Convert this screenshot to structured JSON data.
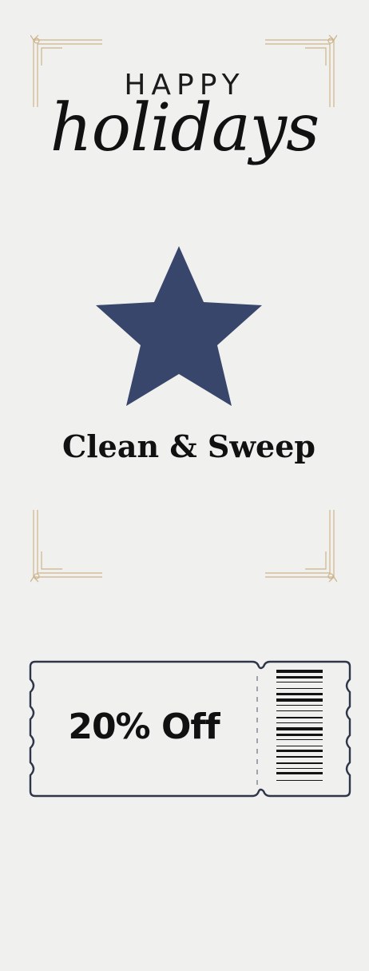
{
  "card": {
    "greeting_top": "HAPPY",
    "greeting_script": "holidays",
    "business_name": "Clean & Sweep"
  },
  "coupon": {
    "discount_text": "20% Off"
  },
  "colors": {
    "background": "#f0f0ef",
    "star": "#39466b",
    "gold_ornament": "#cdb38a",
    "ticket_outline": "#2e3648"
  },
  "icons": {
    "star": "star-icon",
    "barcode": "barcode-icon",
    "corners": "corner-ornament-icon"
  }
}
